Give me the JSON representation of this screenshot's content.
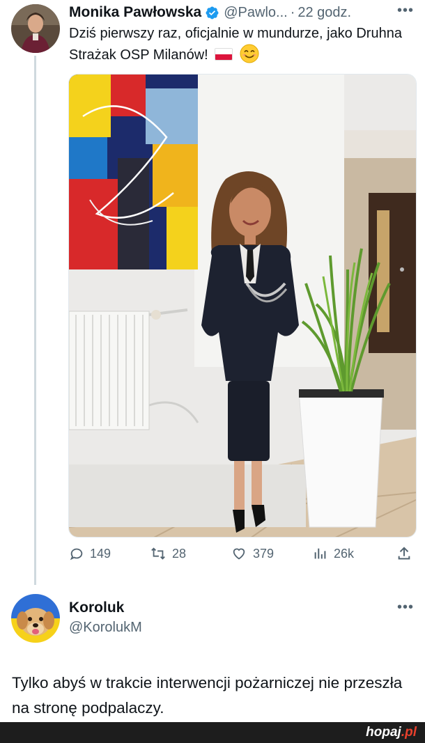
{
  "tweet": {
    "author_name": "Monika Pawłowska",
    "author_handle": "@Pawlo...",
    "separator": "·",
    "time": "22 godz.",
    "more": "•••",
    "text": "Dziś pierwszy raz, oficjalnie w mundurze, jako Druhna Strażak OSP Milanów!",
    "emojis": [
      "flag-poland-icon",
      "smiling-face-icon"
    ],
    "stats": {
      "replies": "149",
      "retweets": "28",
      "likes": "379",
      "views": "26k"
    }
  },
  "reply": {
    "author_name": "Koroluk",
    "author_handle": "@KorolukM",
    "more": "•••",
    "text": "Tylko abyś w trakcie interwencji pożarniczej nie przeszła na stronę podpalaczy."
  },
  "footer": {
    "watermark_main": "hopaj",
    "watermark_tld": ".pl"
  },
  "colors": {
    "text_primary": "#0f1419",
    "text_secondary": "#536471",
    "verified_blue": "#1d9bf0",
    "thread_line": "#cfd9de",
    "footer_bg": "#1d1d1d",
    "watermark_accent": "#e8402c"
  }
}
